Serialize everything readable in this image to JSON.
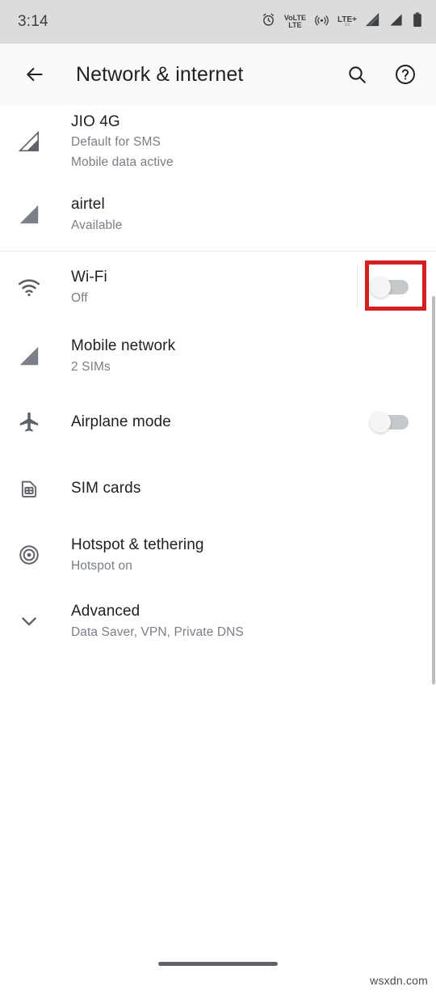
{
  "status_bar": {
    "time": "3:14",
    "icons": [
      {
        "name": "alarm-icon",
        "label": "alarm"
      },
      {
        "name": "volte-icon",
        "label_top": "VoLTE",
        "label_bottom": "LTE"
      },
      {
        "name": "hotspot-status-icon",
        "label": "hotspot"
      },
      {
        "name": "lte-plus-icon",
        "label_top": "LTE+",
        "label_bottom": "1x"
      },
      {
        "name": "signal-sim1-icon",
        "label": "signal"
      },
      {
        "name": "signal-sim2-icon",
        "label": "signal"
      },
      {
        "name": "battery-icon",
        "label": "battery"
      }
    ]
  },
  "app_bar": {
    "title": "Network & internet",
    "back_label": "Back",
    "search_label": "Search",
    "help_label": "Help"
  },
  "sim_section": [
    {
      "icon": "signal-bars-icon",
      "title": "JIO 4G",
      "sub1": "Default for SMS",
      "sub2": "Mobile data active"
    },
    {
      "icon": "signal-bars-icon",
      "title": "airtel",
      "sub1": "Available",
      "sub2": ""
    }
  ],
  "settings_rows": [
    {
      "icon": "wifi-icon",
      "title": "Wi-Fi",
      "sub": "Off",
      "toggle": "off"
    },
    {
      "icon": "signal-bars-icon",
      "title": "Mobile network",
      "sub": "2 SIMs",
      "toggle": "none"
    },
    {
      "icon": "airplane-icon",
      "title": "Airplane mode",
      "sub": "",
      "toggle": "off"
    },
    {
      "icon": "sim-card-icon",
      "title": "SIM cards",
      "sub": "",
      "toggle": "none"
    },
    {
      "icon": "hotspot-icon",
      "title": "Hotspot & tethering",
      "sub": "Hotspot on",
      "toggle": "none"
    },
    {
      "icon": "chevron-down-icon",
      "title": "Advanced",
      "sub": "Data Saver, VPN, Private DNS",
      "toggle": "none"
    }
  ],
  "annotation": {
    "target": "wifi-toggle",
    "color": "#d32020"
  },
  "watermark": "wsxdn.com",
  "colors": {
    "status_bar_bg": "#dcdcdc",
    "app_bar_bg": "#fafafa",
    "content_bg": "#ffffff",
    "title_text": "#202124",
    "sub_text": "#7a7f85",
    "icon": "#5f6368",
    "annotation": "#d32020"
  }
}
